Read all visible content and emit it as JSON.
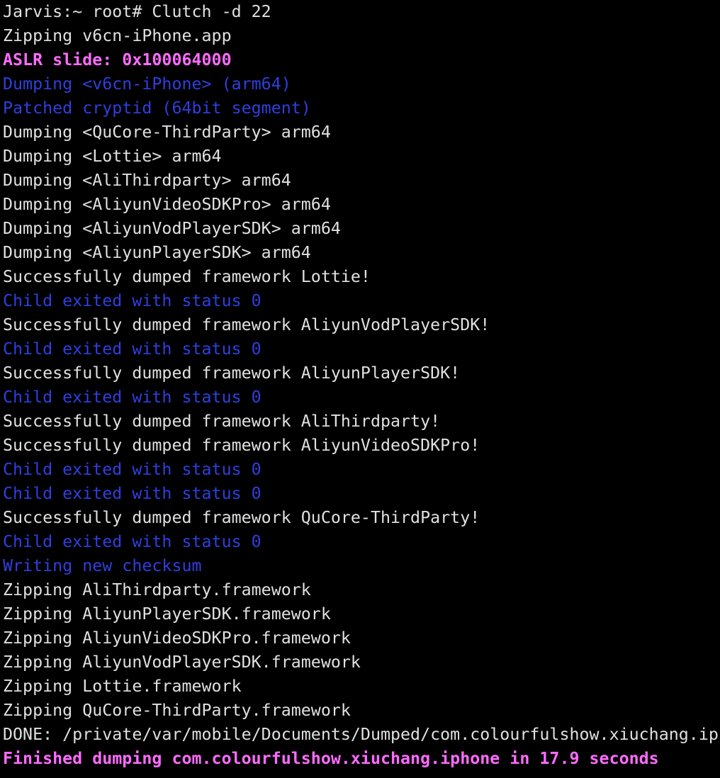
{
  "colors": {
    "background": "#000000",
    "default": "#e0e0e0",
    "blue": "#2f3fe0",
    "magenta": "#ff6bff"
  },
  "lines": [
    {
      "text": "Jarvis:~ root# Clutch -d 22",
      "style": "default"
    },
    {
      "text": "Zipping v6cn-iPhone.app",
      "style": "default"
    },
    {
      "text": "ASLR slide: 0x100064000",
      "style": "magenta"
    },
    {
      "text": "Dumping <v6cn-iPhone> (arm64)",
      "style": "blue"
    },
    {
      "text": "Patched cryptid (64bit segment)",
      "style": "blue"
    },
    {
      "text": "Dumping <QuCore-ThirdParty> arm64",
      "style": "default"
    },
    {
      "text": "Dumping <Lottie> arm64",
      "style": "default"
    },
    {
      "text": "Dumping <AliThirdparty> arm64",
      "style": "default"
    },
    {
      "text": "Dumping <AliyunVideoSDKPro> arm64",
      "style": "default"
    },
    {
      "text": "Dumping <AliyunVodPlayerSDK> arm64",
      "style": "default"
    },
    {
      "text": "Dumping <AliyunPlayerSDK> arm64",
      "style": "default"
    },
    {
      "text": "Successfully dumped framework Lottie!",
      "style": "default"
    },
    {
      "text": "Child exited with status 0",
      "style": "blue"
    },
    {
      "text": "Successfully dumped framework AliyunVodPlayerSDK!",
      "style": "default"
    },
    {
      "text": "Child exited with status 0",
      "style": "blue"
    },
    {
      "text": "Successfully dumped framework AliyunPlayerSDK!",
      "style": "default"
    },
    {
      "text": "Child exited with status 0",
      "style": "blue"
    },
    {
      "text": "Successfully dumped framework AliThirdparty!",
      "style": "default"
    },
    {
      "text": "Successfully dumped framework AliyunVideoSDKPro!",
      "style": "default"
    },
    {
      "text": "Child exited with status 0",
      "style": "blue"
    },
    {
      "text": "Child exited with status 0",
      "style": "blue"
    },
    {
      "text": "Successfully dumped framework QuCore-ThirdParty!",
      "style": "default"
    },
    {
      "text": "Child exited with status 0",
      "style": "blue"
    },
    {
      "text": "Writing new checksum",
      "style": "blue"
    },
    {
      "text": "Zipping AliThirdparty.framework",
      "style": "default"
    },
    {
      "text": "Zipping AliyunPlayerSDK.framework",
      "style": "default"
    },
    {
      "text": "Zipping AliyunVideoSDKPro.framework",
      "style": "default"
    },
    {
      "text": "Zipping AliyunVodPlayerSDK.framework",
      "style": "default"
    },
    {
      "text": "Zipping Lottie.framework",
      "style": "default"
    },
    {
      "text": "Zipping QuCore-ThirdParty.framework",
      "style": "default"
    },
    {
      "text": "DONE: /private/var/mobile/Documents/Dumped/com.colourfulshow.xiuchang.iph",
      "style": "default"
    },
    {
      "text": "Finished dumping com.colourfulshow.xiuchang.iphone in 17.9 seconds",
      "style": "magenta"
    }
  ]
}
